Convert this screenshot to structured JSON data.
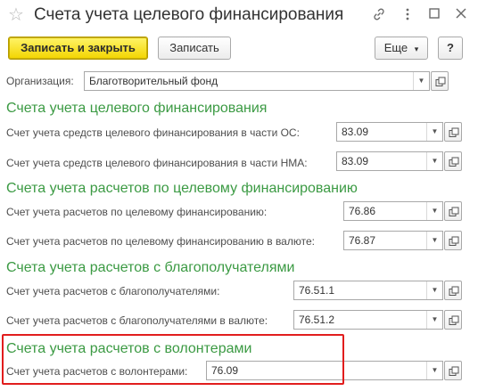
{
  "window": {
    "title": "Счета учета целевого финансирования",
    "icons": [
      "star-icon",
      "link-icon",
      "more-icon",
      "maximize-icon",
      "close-icon"
    ]
  },
  "toolbar": {
    "save_close_label": "Записать и закрыть",
    "save_label": "Записать",
    "more_label": "Еще",
    "more_arrow": "▾",
    "help_label": "?"
  },
  "organization": {
    "label": "Организация:",
    "value": "Благотворительный фонд"
  },
  "sections": [
    {
      "title": "Счета учета целевого финансирования",
      "rows": [
        {
          "label": "Счет учета средств целевого финансирования в части ОС:",
          "value": "83.09"
        },
        {
          "label": "Счет учета средств целевого финансирования в части НМА:",
          "value": "83.09"
        }
      ]
    },
    {
      "title": "Счета учета расчетов по целевому финансированию",
      "rows": [
        {
          "label": "Счет учета расчетов по целевому финансированию:",
          "value": "76.86"
        },
        {
          "label": "Счет учета расчетов по целевому финансированию в валюте:",
          "value": "76.87"
        }
      ]
    },
    {
      "title": "Счета учета расчетов с благополучателями",
      "rows": [
        {
          "label": "Счет учета расчетов с благополучателями:",
          "value": "76.51.1"
        },
        {
          "label": "Счет учета расчетов с благополучателями в валюте:",
          "value": "76.51.2"
        }
      ]
    },
    {
      "title": "Счета учета расчетов с волонтерами",
      "rows": [
        {
          "label": "Счет учета расчетов с волонтерами:",
          "value": "76.09"
        }
      ]
    }
  ],
  "colors": {
    "section_title": "#3b9a43",
    "primary_button": "#f3d500",
    "highlight_border": "#e11d1d"
  }
}
